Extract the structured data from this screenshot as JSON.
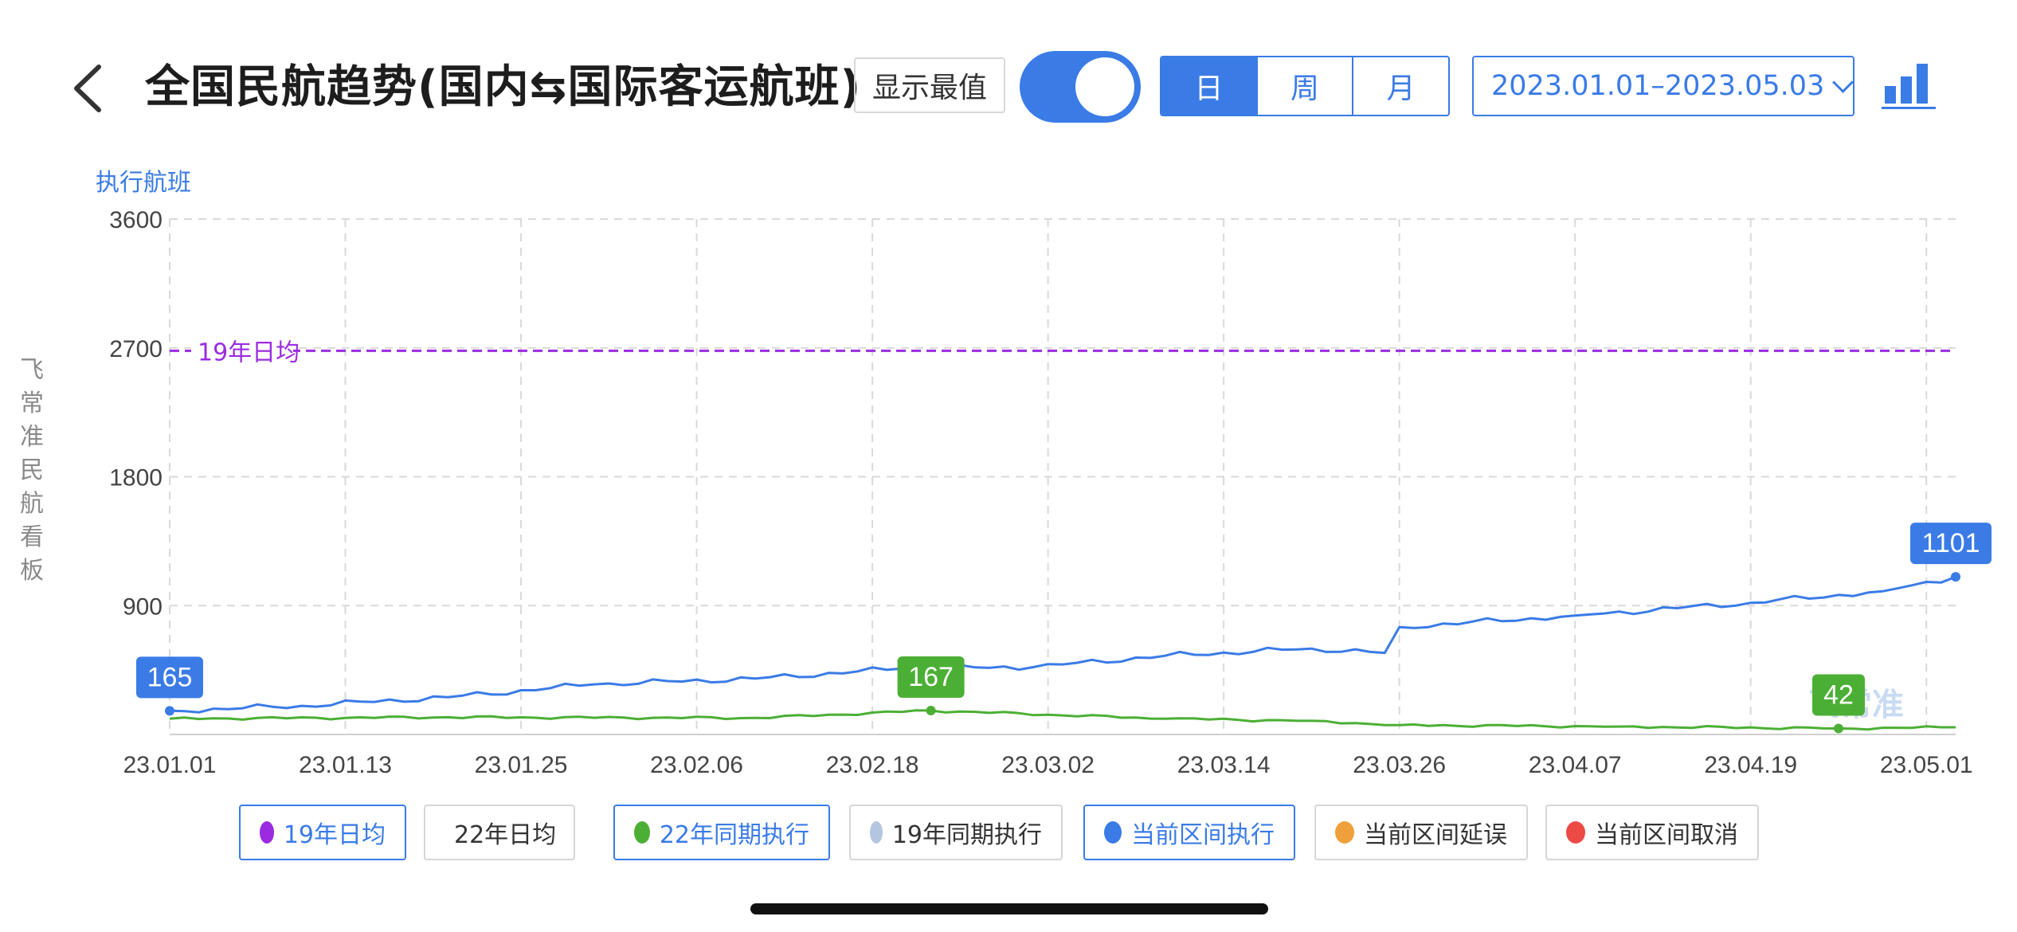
{
  "header": {
    "title": "全国民航趋势(国内⇆国际客运航班)",
    "show_max_label": "显示最值",
    "show_max_on": true,
    "period_tabs": [
      {
        "label": "日",
        "active": true
      },
      {
        "label": "周",
        "active": false
      },
      {
        "label": "月",
        "active": false
      }
    ],
    "date_range": "2023.01.01–2023.05.03",
    "icons": {
      "back": "chevron-left-icon",
      "chart": "bar-chart-icon",
      "dropdown": "chevron-down-icon"
    }
  },
  "side_watermark": "飞常准民航看板",
  "logo_watermark": "飞常准",
  "legend": [
    {
      "label": "19年日均",
      "color": "#9b2be0",
      "active": true
    },
    {
      "label": "22年日均",
      "color": "#8c8c8c",
      "active": false
    },
    {
      "label": "22年同期执行",
      "color": "#4caf35",
      "active": true
    },
    {
      "label": "19年同期执行",
      "color": "#b4c6df",
      "active": false
    },
    {
      "label": "当前区间执行",
      "color": "#3a7be6",
      "active": true
    },
    {
      "label": "当前区间延误",
      "color": "#f0a03a",
      "active": false
    },
    {
      "label": "当前区间取消",
      "color": "#ec4a45",
      "active": false
    }
  ],
  "chart_data": {
    "type": "line",
    "ylabel": "执行航班",
    "ylim": [
      0,
      3600
    ],
    "yticks": [
      900,
      1800,
      2700,
      3600
    ],
    "grid": true,
    "xlim": [
      "2023-01-01",
      "2023-05-03"
    ],
    "x_tick_labels": [
      "23.01.01",
      "23.01.13",
      "23.01.25",
      "23.02.06",
      "23.02.18",
      "23.03.02",
      "23.03.14",
      "23.03.26",
      "23.04.07",
      "23.04.19",
      "23.05.01"
    ],
    "reference_line": {
      "label": "19年日均",
      "value": 2680,
      "color": "#9b2be0",
      "style": "dashed"
    },
    "series": [
      {
        "name": "当前区间执行",
        "color": "#3a7be6",
        "keypoints": [
          {
            "date": "2023-01-01",
            "value": 165
          },
          {
            "date": "2023-01-10",
            "value": 200
          },
          {
            "date": "2023-01-20",
            "value": 260
          },
          {
            "date": "2023-01-30",
            "value": 350
          },
          {
            "date": "2023-02-10",
            "value": 390
          },
          {
            "date": "2023-02-20",
            "value": 460
          },
          {
            "date": "2023-03-01",
            "value": 470
          },
          {
            "date": "2023-03-10",
            "value": 550
          },
          {
            "date": "2023-03-20",
            "value": 600
          },
          {
            "date": "2023-03-25",
            "value": 570
          },
          {
            "date": "2023-03-26",
            "value": 750
          },
          {
            "date": "2023-04-07",
            "value": 830
          },
          {
            "date": "2023-04-19",
            "value": 920
          },
          {
            "date": "2023-04-28",
            "value": 1000
          },
          {
            "date": "2023-05-03",
            "value": 1101
          }
        ],
        "annotations": [
          {
            "date": "2023-01-01",
            "value": 165,
            "label": "165"
          },
          {
            "date": "2023-05-03",
            "value": 1101,
            "label": "1101"
          }
        ]
      },
      {
        "name": "22年同期执行",
        "color": "#4caf35",
        "keypoints": [
          {
            "date": "2023-01-01",
            "value": 110
          },
          {
            "date": "2023-01-20",
            "value": 120
          },
          {
            "date": "2023-02-10",
            "value": 115
          },
          {
            "date": "2023-02-22",
            "value": 167
          },
          {
            "date": "2023-03-10",
            "value": 110
          },
          {
            "date": "2023-03-20",
            "value": 95
          },
          {
            "date": "2023-03-26",
            "value": 65
          },
          {
            "date": "2023-04-10",
            "value": 55
          },
          {
            "date": "2023-04-25",
            "value": 42
          },
          {
            "date": "2023-05-03",
            "value": 50
          }
        ],
        "annotations": [
          {
            "date": "2023-02-22",
            "value": 167,
            "label": "167"
          },
          {
            "date": "2023-04-25",
            "value": 42,
            "label": "42"
          }
        ]
      }
    ]
  }
}
